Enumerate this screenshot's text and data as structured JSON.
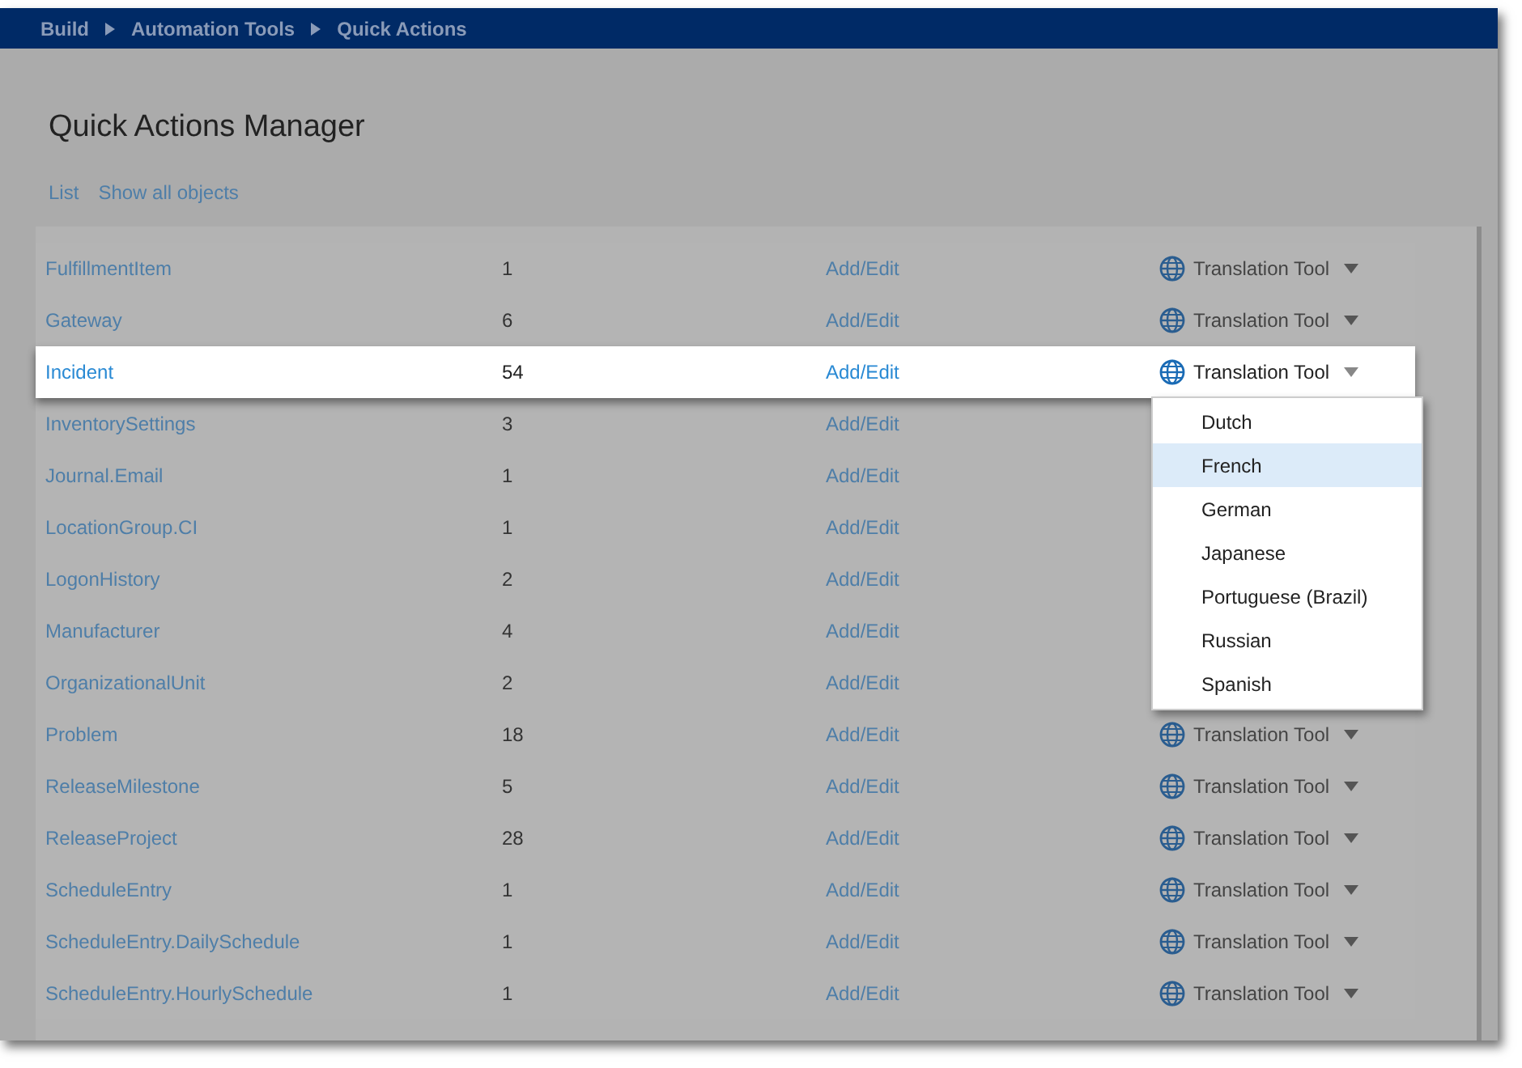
{
  "breadcrumb": [
    "Build",
    "Automation Tools",
    "Quick Actions"
  ],
  "page": {
    "title": "Quick Actions Manager",
    "links": [
      "List",
      "Show all objects"
    ]
  },
  "table": {
    "rows": [
      {
        "name": "FulfillmentItem",
        "count": "1",
        "action": "Add/Edit",
        "tool": "Translation Tool",
        "highlighted": false
      },
      {
        "name": "Gateway",
        "count": "6",
        "action": "Add/Edit",
        "tool": "Translation Tool",
        "highlighted": false
      },
      {
        "name": "Incident",
        "count": "54",
        "action": "Add/Edit",
        "tool": "Translation Tool",
        "highlighted": true
      },
      {
        "name": "InventorySettings",
        "count": "3",
        "action": "Add/Edit",
        "highlighted": false
      },
      {
        "name": "Journal.Email",
        "count": "1",
        "action": "Add/Edit",
        "highlighted": false
      },
      {
        "name": "LocationGroup.CI",
        "count": "1",
        "action": "Add/Edit",
        "highlighted": false
      },
      {
        "name": "LogonHistory",
        "count": "2",
        "action": "Add/Edit",
        "highlighted": false
      },
      {
        "name": "Manufacturer",
        "count": "4",
        "action": "Add/Edit",
        "highlighted": false
      },
      {
        "name": "OrganizationalUnit",
        "count": "2",
        "action": "Add/Edit",
        "highlighted": false
      },
      {
        "name": "Problem",
        "count": "18",
        "action": "Add/Edit",
        "tool": "Translation Tool",
        "highlighted": false
      },
      {
        "name": "ReleaseMilestone",
        "count": "5",
        "action": "Add/Edit",
        "tool": "Translation Tool",
        "highlighted": false
      },
      {
        "name": "ReleaseProject",
        "count": "28",
        "action": "Add/Edit",
        "tool": "Translation Tool",
        "highlighted": false
      },
      {
        "name": "ScheduleEntry",
        "count": "1",
        "action": "Add/Edit",
        "tool": "Translation Tool",
        "highlighted": false
      },
      {
        "name": "ScheduleEntry.DailySchedule",
        "count": "1",
        "action": "Add/Edit",
        "tool": "Translation Tool",
        "highlighted": false
      },
      {
        "name": "ScheduleEntry.HourlySchedule",
        "count": "1",
        "action": "Add/Edit",
        "tool": "Translation Tool",
        "highlighted": false
      }
    ]
  },
  "language_menu": {
    "items": [
      {
        "label": "Dutch",
        "selected": false
      },
      {
        "label": "French",
        "selected": true
      },
      {
        "label": "German",
        "selected": false
      },
      {
        "label": "Japanese",
        "selected": false
      },
      {
        "label": "Portuguese (Brazil)",
        "selected": false
      },
      {
        "label": "Russian",
        "selected": false
      },
      {
        "label": "Spanish",
        "selected": false
      }
    ]
  }
}
